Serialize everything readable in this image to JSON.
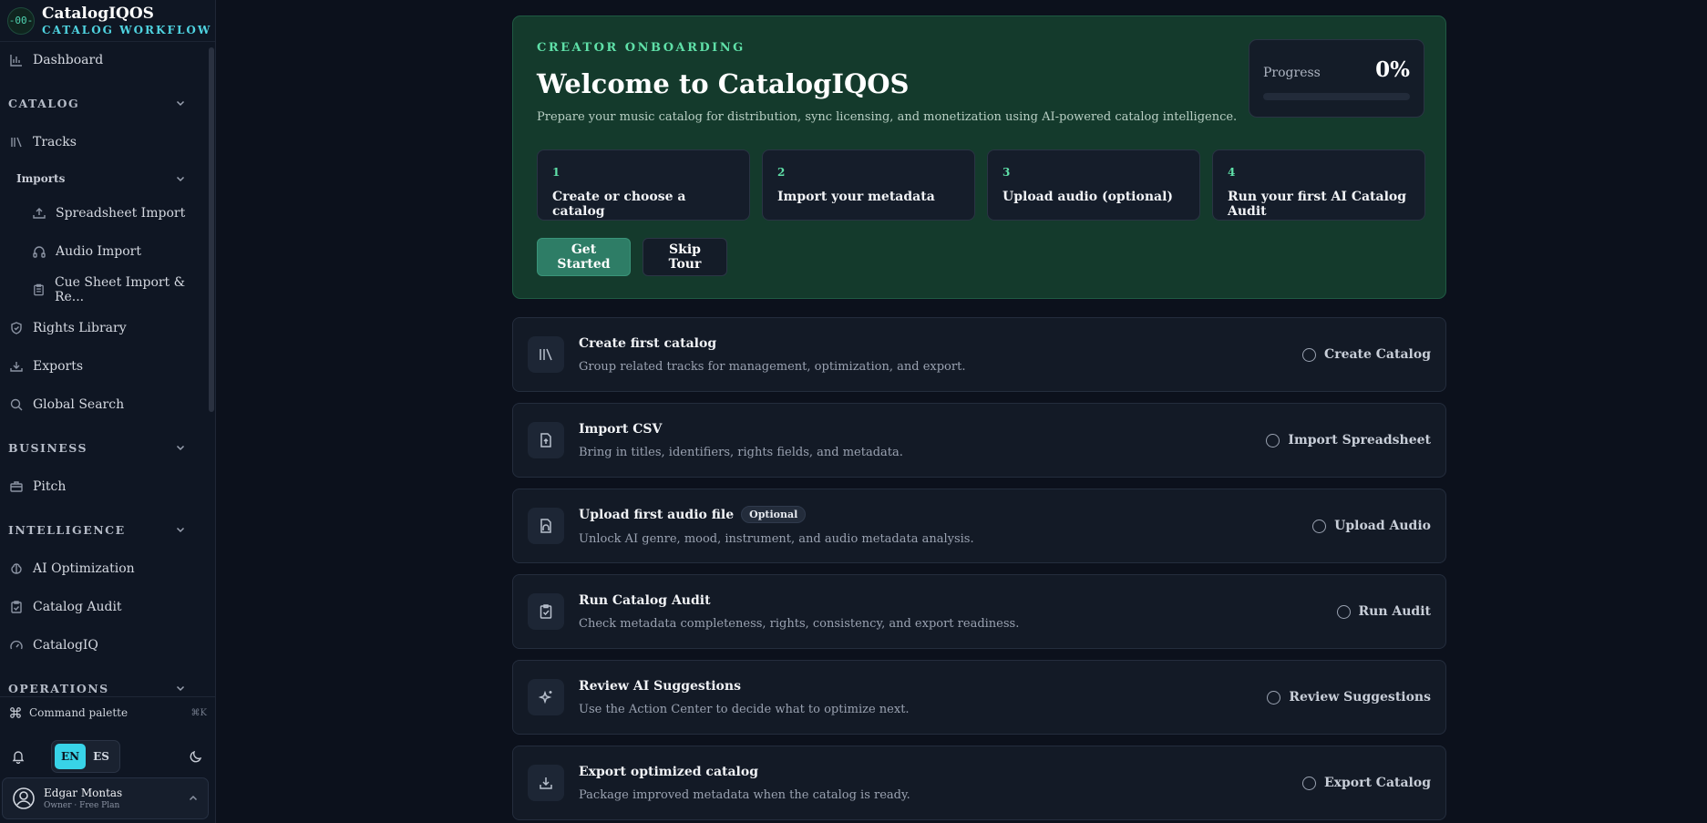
{
  "brand": {
    "logo": "-00-",
    "name": "CatalogIQOS",
    "subtitle": "CATALOG WORKFLOW"
  },
  "sidebar": {
    "dashboard": "Dashboard",
    "catalog_section": "CATALOG",
    "tracks": "Tracks",
    "imports_group": "Imports",
    "spreadsheet_import": "Spreadsheet Import",
    "audio_import": "Audio Import",
    "cue_sheet_import": "Cue Sheet Import & Re...",
    "rights_library": "Rights Library",
    "exports": "Exports",
    "global_search": "Global Search",
    "business_section": "BUSINESS",
    "pitch": "Pitch",
    "intelligence_section": "INTELLIGENCE",
    "ai_optimization": "AI Optimization",
    "catalog_audit": "Catalog Audit",
    "catalogiq": "CatalogIQ",
    "operations_section": "OPERATIONS"
  },
  "footer": {
    "command_palette": "Command palette",
    "command_shortcut": "⌘K",
    "lang_en": "EN",
    "lang_es": "ES",
    "user_name": "Edgar Montas",
    "user_role": "Owner · Free Plan"
  },
  "hero": {
    "eyebrow": "CREATOR ONBOARDING",
    "title": "Welcome to CatalogIQOS",
    "description": "Prepare your music catalog for distribution, sync licensing, and monetization using AI-powered catalog intelligence.",
    "progress_label": "Progress",
    "progress_value": "0%",
    "progress_fraction": 0,
    "steps": [
      {
        "num": "1",
        "title": "Create or choose a catalog"
      },
      {
        "num": "2",
        "title": "Import your metadata"
      },
      {
        "num": "3",
        "title": "Upload audio (optional)"
      },
      {
        "num": "4",
        "title": "Run your first AI Catalog Audit"
      }
    ],
    "get_started": "Get Started",
    "skip_tour": "Skip Tour"
  },
  "tasks": [
    {
      "title": "Create first catalog",
      "badge": "",
      "description": "Group related tracks for management, optimization, and export.",
      "action": "Create Catalog",
      "icon": "library-icon"
    },
    {
      "title": "Import CSV",
      "badge": "",
      "description": "Bring in titles, identifiers, rights fields, and metadata.",
      "action": "Import Spreadsheet",
      "icon": "file-upload-icon"
    },
    {
      "title": "Upload first audio file",
      "badge": "Optional",
      "description": "Unlock AI genre, mood, instrument, and audio metadata analysis.",
      "action": "Upload Audio",
      "icon": "audio-file-icon"
    },
    {
      "title": "Run Catalog Audit",
      "badge": "",
      "description": "Check metadata completeness, rights, consistency, and export readiness.",
      "action": "Run Audit",
      "icon": "clipboard-check-icon"
    },
    {
      "title": "Review AI Suggestions",
      "badge": "",
      "description": "Use the Action Center to decide what to optimize next.",
      "action": "Review Suggestions",
      "icon": "sparkles-icon"
    },
    {
      "title": "Export optimized catalog",
      "badge": "",
      "description": "Package improved metadata when the catalog is ready.",
      "action": "Export Catalog",
      "icon": "download-icon"
    }
  ]
}
